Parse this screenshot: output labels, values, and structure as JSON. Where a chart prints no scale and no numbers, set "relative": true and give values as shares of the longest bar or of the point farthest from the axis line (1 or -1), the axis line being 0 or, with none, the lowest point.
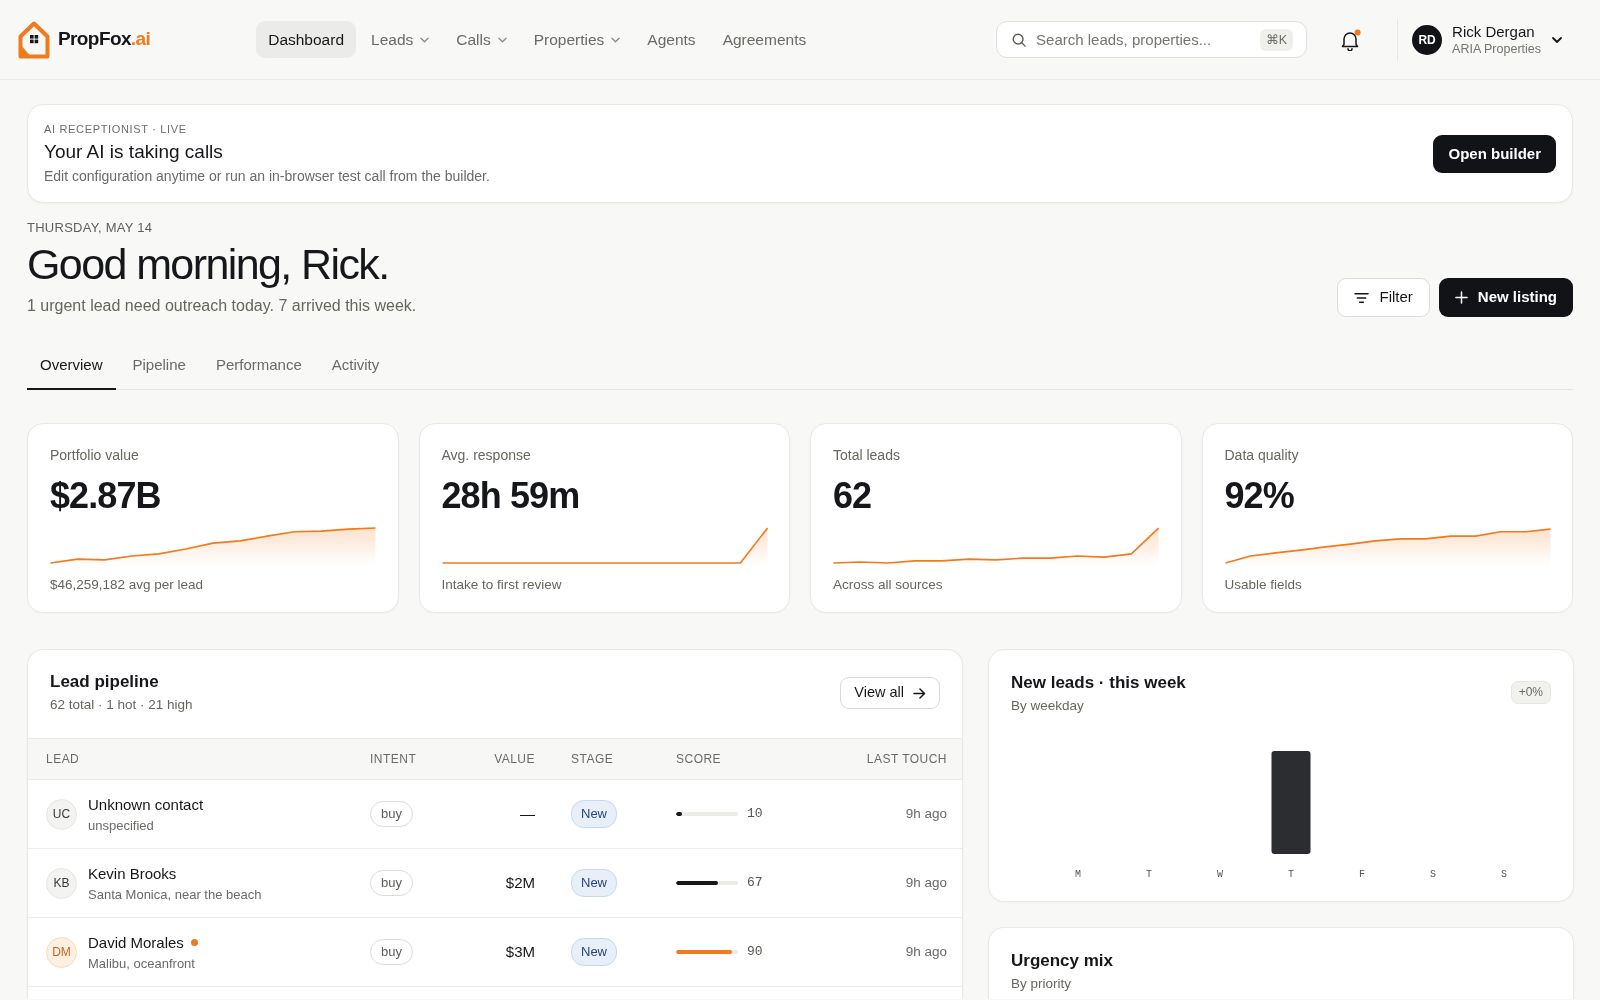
{
  "brand": {
    "name": "PropFox",
    "suffix": ".ai"
  },
  "nav": [
    {
      "label": "Dashboard",
      "kind": "link",
      "selected": true
    },
    {
      "label": "Leads",
      "kind": "menu",
      "selected": false
    },
    {
      "label": "Calls",
      "kind": "menu",
      "selected": false
    },
    {
      "label": "Properties",
      "kind": "menu",
      "selected": false
    },
    {
      "label": "Agents",
      "kind": "link",
      "selected": false
    },
    {
      "label": "Agreements",
      "kind": "link",
      "selected": false
    }
  ],
  "search": {
    "placeholder": "Search leads, properties...",
    "shortcut": "⌘K"
  },
  "notifications": {
    "unread": true
  },
  "user": {
    "initials": "RD",
    "name": "Rick Dergan",
    "organization": "ARIA Properties"
  },
  "banner": {
    "eyebrow": "AI RECEPTIONIST · LIVE",
    "title": "Your AI is taking calls",
    "text": "Edit configuration anytime or run an in-browser test call from the builder.",
    "button": "Open builder"
  },
  "greeting": {
    "date": "THURSDAY, MAY 14",
    "heading": "Good morning, Rick.",
    "summary": "1 urgent lead need outreach today. 7 arrived this week."
  },
  "actions": [
    {
      "label": "Filter",
      "kind": "filter"
    },
    {
      "label": "New listing",
      "kind": "create"
    }
  ],
  "tabs": [
    {
      "label": "Overview",
      "selected": true
    },
    {
      "label": "Pipeline",
      "selected": false
    },
    {
      "label": "Performance",
      "selected": false
    },
    {
      "label": "Activity",
      "selected": false
    }
  ],
  "stats": [
    {
      "label": "Portfolio value",
      "value": "$2.87B",
      "caption": "$46,259,182 avg per lead"
    },
    {
      "label": "Avg. response",
      "value": "28h 59m",
      "caption": "Intake to first review"
    },
    {
      "label": "Total leads",
      "value": "62",
      "caption": "Across all sources"
    },
    {
      "label": "Data quality",
      "value": "92%",
      "caption": "Usable fields"
    }
  ],
  "pipeline": {
    "title": "Lead pipeline",
    "subtitle": "62 total · 1 hot · 21 high",
    "button": "View all",
    "columns": [
      "LEAD",
      "INTENT",
      "VALUE",
      "STAGE",
      "SCORE",
      "LAST TOUCH"
    ],
    "rows": [
      {
        "initials": "UC",
        "name": "Unknown contact",
        "detail": "unspecified",
        "hot": false,
        "intent": "buy",
        "value": "—",
        "stage": "New",
        "score": {
          "level": 0.1,
          "reading": "10"
        },
        "last_touch": "9h ago"
      },
      {
        "initials": "KB",
        "name": "Kevin Brooks",
        "detail": "Santa Monica, near the beach",
        "hot": false,
        "intent": "buy",
        "value": "$2M",
        "stage": "New",
        "score": {
          "level": 0.67,
          "reading": "67"
        },
        "last_touch": "9h ago"
      },
      {
        "initials": "DM",
        "name": "David Morales",
        "detail": "Malibu, oceanfront",
        "hot": true,
        "intent": "buy",
        "value": "$3M",
        "stage": "New",
        "score": {
          "level": 0.9,
          "reading": "90"
        },
        "last_touch": "9h ago"
      }
    ]
  },
  "new_leads": {
    "title": "New leads · this week",
    "subtitle": "By weekday",
    "badge": "+0%",
    "chart_data": {
      "type": "bar",
      "relative": true,
      "categories": [
        "M",
        "T",
        "W",
        "T",
        "F",
        "S",
        "S"
      ],
      "values": [
        0,
        0,
        0,
        1,
        0,
        0,
        0
      ]
    }
  },
  "urgency": {
    "title": "Urgency mix",
    "subtitle": "By priority"
  }
}
